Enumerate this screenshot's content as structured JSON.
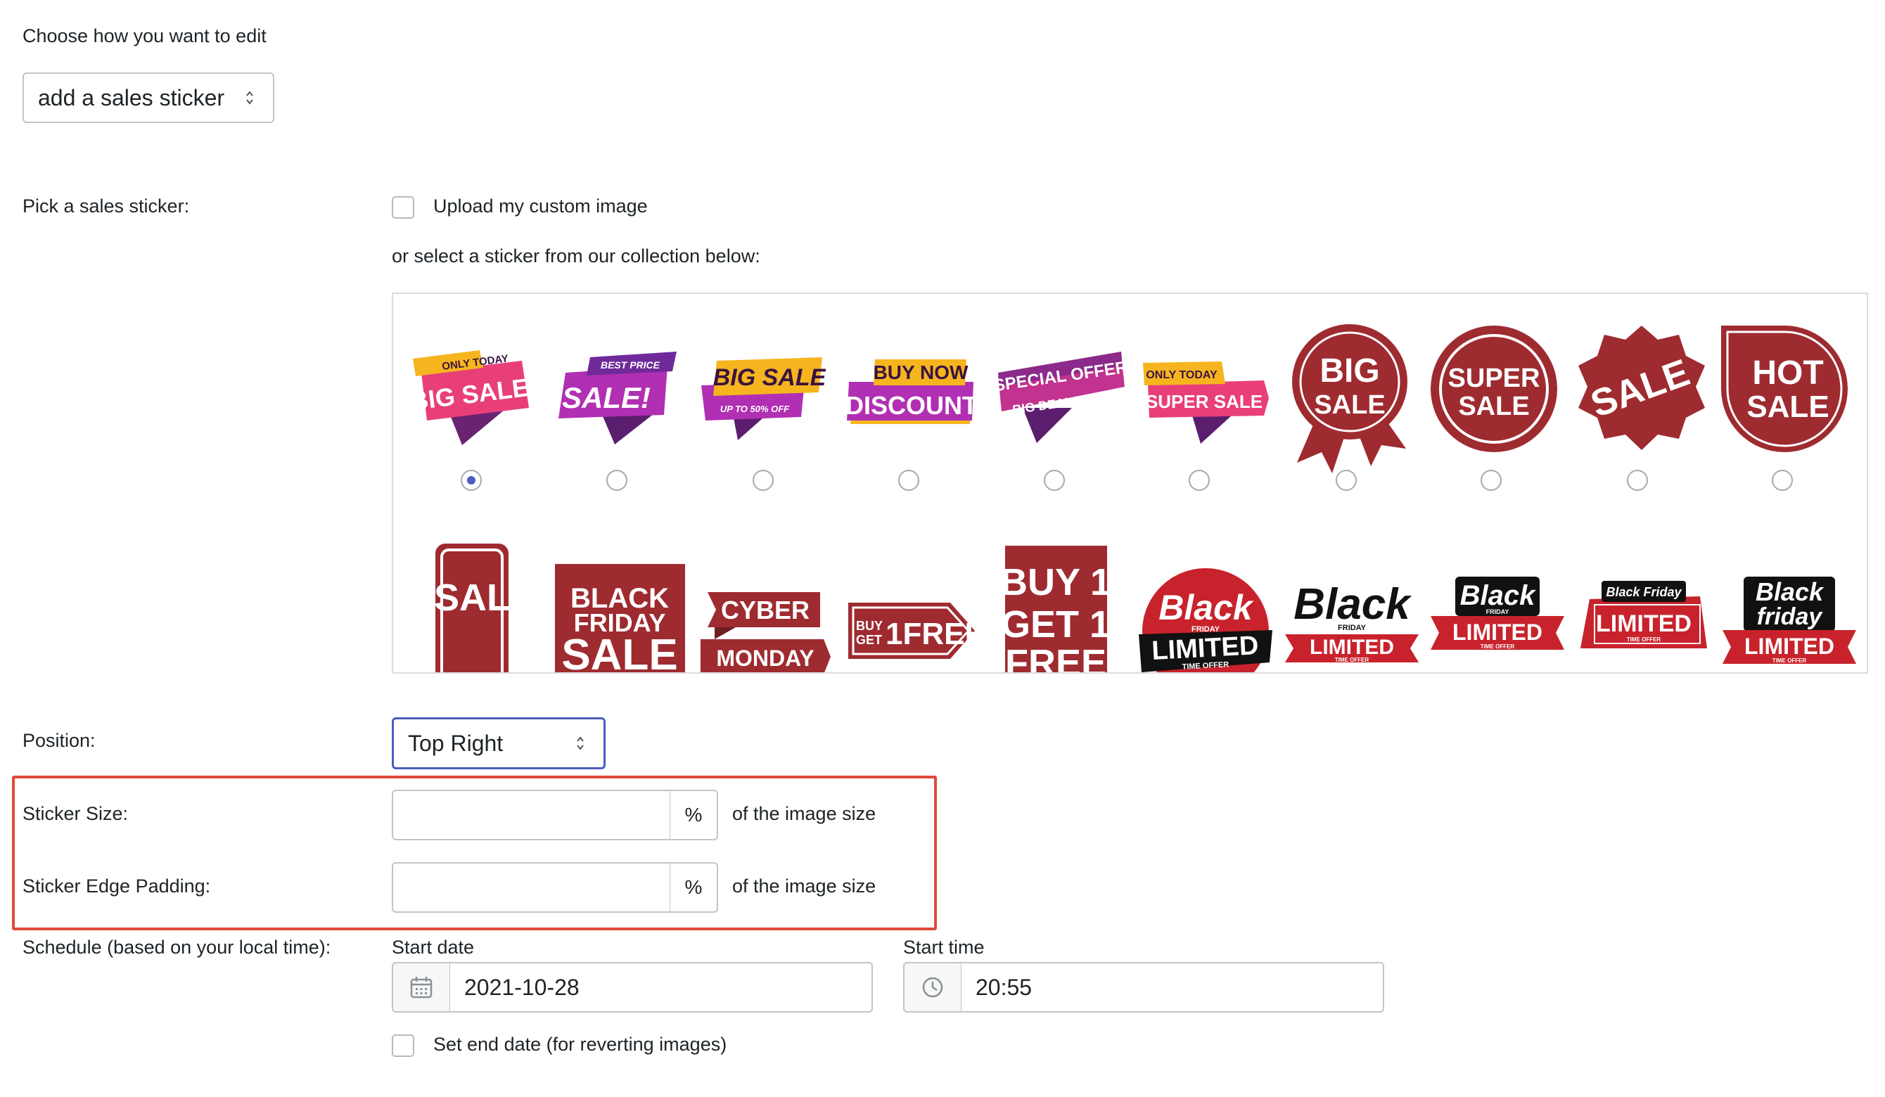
{
  "edit_mode": {
    "label": "Choose how you want to edit",
    "selected": "add a sales sticker"
  },
  "sticker_picker": {
    "label": "Pick a sales sticker:",
    "upload_label": "Upload my custom image",
    "upload_checked": false,
    "collection_hint": "or select a sticker from our collection below:",
    "selected_index": 0,
    "row1": [
      {
        "icon": "sticker-big-sale-only-today",
        "small": "ONLY TODAY",
        "main": "BIG SALE"
      },
      {
        "icon": "sticker-sale-best-price",
        "small": "BEST PRICE",
        "main": "SALE!"
      },
      {
        "icon": "sticker-big-sale-up-to-50",
        "small": "UP TO 50% OFF",
        "main": "BIG SALE"
      },
      {
        "icon": "sticker-buy-now-discount",
        "small": "BUY NOW",
        "main": "DISCOUNT"
      },
      {
        "icon": "sticker-special-offer-big-deals",
        "small": "BIG DEALS",
        "main": "SPECIAL OFFER"
      },
      {
        "icon": "sticker-super-sale-only-today",
        "small": "ONLY TODAY",
        "main": "SUPER SALE"
      },
      {
        "icon": "sticker-big-sale-badge",
        "line1": "BIG",
        "line2": "SALE"
      },
      {
        "icon": "sticker-super-sale-badge",
        "line1": "SUPER",
        "line2": "SALE"
      },
      {
        "icon": "sticker-sale-badge",
        "line1": "SALE"
      },
      {
        "icon": "sticker-hot-sale-badge",
        "line1": "HOT",
        "line2": "SALE"
      }
    ],
    "row2": [
      {
        "icon": "sticker-sale-vertical",
        "text": "SAL"
      },
      {
        "icon": "sticker-black-friday-sale",
        "line1": "BLACK",
        "line2": "FRIDAY",
        "line3": "SALE"
      },
      {
        "icon": "sticker-cyber-monday",
        "line1": "CYBER",
        "line2": "MONDAY"
      },
      {
        "icon": "sticker-buy-1-get-1-free-tag",
        "small1": "BUY",
        "small2": "GET",
        "main": "1FREE"
      },
      {
        "icon": "sticker-buy-1-get-1-free",
        "line1": "BUY 1",
        "line2": "GET 1",
        "line3": "FREE"
      },
      {
        "icon": "sticker-black-friday-limited-round",
        "script": "Black",
        "tiny": "FRIDAY",
        "main": "LIMITED",
        "sub": "TIME OFFER"
      },
      {
        "icon": "sticker-black-friday-limited-1",
        "script": "Black",
        "tiny": "FRIDAY",
        "main": "LIMITED",
        "sub": "TIME OFFER"
      },
      {
        "icon": "sticker-black-friday-limited-2",
        "script": "Black",
        "tiny": "FRIDAY",
        "main": "LIMITED",
        "sub": "TIME OFFER"
      },
      {
        "icon": "sticker-black-friday-limited-3",
        "script": "Black Friday",
        "main": "LIMITED",
        "sub": "TIME OFFER"
      },
      {
        "icon": "sticker-black-friday-limited-4",
        "script": "Black",
        "script2": "friday",
        "main": "LIMITED",
        "sub": "TIME OFFER"
      }
    ]
  },
  "position": {
    "label": "Position:",
    "selected": "Top Right"
  },
  "sticker_size": {
    "label": "Sticker Size:",
    "value": "",
    "unit": "%",
    "suffix": "of the image size"
  },
  "edge_padding": {
    "label": "Sticker Edge Padding:",
    "value": "",
    "unit": "%",
    "suffix": "of the image size"
  },
  "schedule": {
    "label": "Schedule (based on your local time):",
    "start_date_label": "Start date",
    "start_date": "2021-10-28",
    "start_time_label": "Start time",
    "start_time": "20:55",
    "end_date_label": "Set end date (for reverting images)",
    "end_date_checked": false
  },
  "colors": {
    "accent": "#4c5dbd",
    "highlight": "#e14a38",
    "sticker_red": "#9e2b30",
    "sticker_pink": "#e83f78",
    "sticker_purple": "#7b2a8f",
    "sticker_yellow": "#f6b51e"
  }
}
